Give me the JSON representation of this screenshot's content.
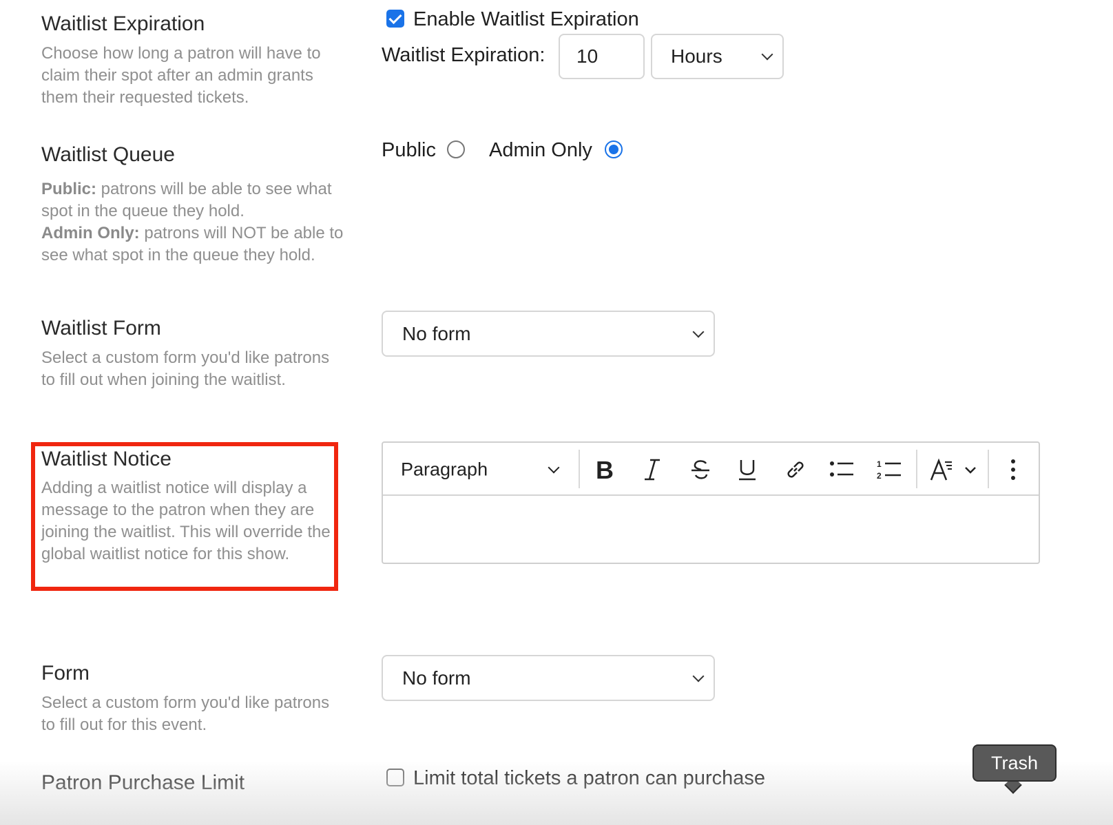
{
  "sections": {
    "waitlist_expiration": {
      "title": "Waitlist Expiration",
      "description": "Choose how long a patron will have to claim their spot after an admin grants them their requested tickets.",
      "enable_label": "Enable Waitlist Expiration",
      "enable_checked": true,
      "field_label": "Waitlist Expiration:",
      "value": "10",
      "unit": "Hours"
    },
    "waitlist_queue": {
      "title": "Waitlist Queue",
      "public_bold": "Public:",
      "public_desc": " patrons will be able to see what spot in the queue they hold.",
      "admin_bold": "Admin Only:",
      "admin_desc": " patrons will NOT be able to see what spot in the queue they hold.",
      "option_public": "Public",
      "option_admin": "Admin Only",
      "selected": "Admin Only"
    },
    "waitlist_form": {
      "title": "Waitlist Form",
      "description": "Select a custom form you'd like patrons to fill out when joining the waitlist.",
      "selected": "No form"
    },
    "waitlist_notice": {
      "title": "Waitlist Notice",
      "description": "Adding a waitlist notice will display a message to the patron when they are joining the waitlist. This will override the global waitlist notice for this show.",
      "editor": {
        "block_style": "Paragraph",
        "tools": [
          "bold-icon",
          "italic-icon",
          "strikethrough-icon",
          "underline-icon",
          "link-icon",
          "bulleted-list-icon",
          "numbered-list-icon",
          "text-size-icon",
          "more-options-icon"
        ],
        "content": ""
      }
    },
    "form": {
      "title": "Form",
      "description": "Select a custom form you'd like patrons to fill out for this event.",
      "selected": "No form"
    },
    "patron_purchase_limit": {
      "title": "Patron Purchase Limit",
      "checkbox_label": "Limit total tickets a patron can purchase",
      "checked": false
    }
  },
  "tooltip": {
    "text": "Trash"
  },
  "colors": {
    "accent": "#1a73e8",
    "highlight": "#f0260f"
  }
}
